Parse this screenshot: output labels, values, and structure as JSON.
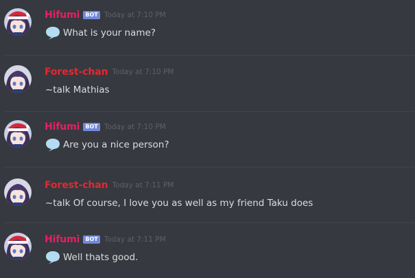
{
  "colors": {
    "background": "#36393f",
    "hifumi_name": "#e91e63",
    "forest_name": "#e7272f",
    "bot_tag": "#7289da",
    "timestamp": "#5e6167",
    "message_text": "#dcddde",
    "speech_bubble": "#b3dcf2"
  },
  "icons": {
    "speech": "speech-balloon-icon"
  },
  "messages": [
    {
      "author": "Hifumi",
      "is_bot": true,
      "bot_tag": "BOT",
      "timestamp": "Today at 7:10 PM",
      "has_speech_icon": true,
      "text": "What is your name?"
    },
    {
      "author": "Forest-chan",
      "is_bot": false,
      "timestamp": "Today at 7:10 PM",
      "has_speech_icon": false,
      "text": "~talk Mathias"
    },
    {
      "author": "Hifumi",
      "is_bot": true,
      "bot_tag": "BOT",
      "timestamp": "Today at 7:10 PM",
      "has_speech_icon": true,
      "text": "Are you a nice person?"
    },
    {
      "author": "Forest-chan",
      "is_bot": false,
      "timestamp": "Today at 7:11 PM",
      "has_speech_icon": false,
      "text": "~talk Of course, I love you as well as my friend Taku does"
    },
    {
      "author": "Hifumi",
      "is_bot": true,
      "bot_tag": "BOT",
      "timestamp": "Today at 7:11 PM",
      "has_speech_icon": true,
      "text": "Well thats good."
    }
  ]
}
